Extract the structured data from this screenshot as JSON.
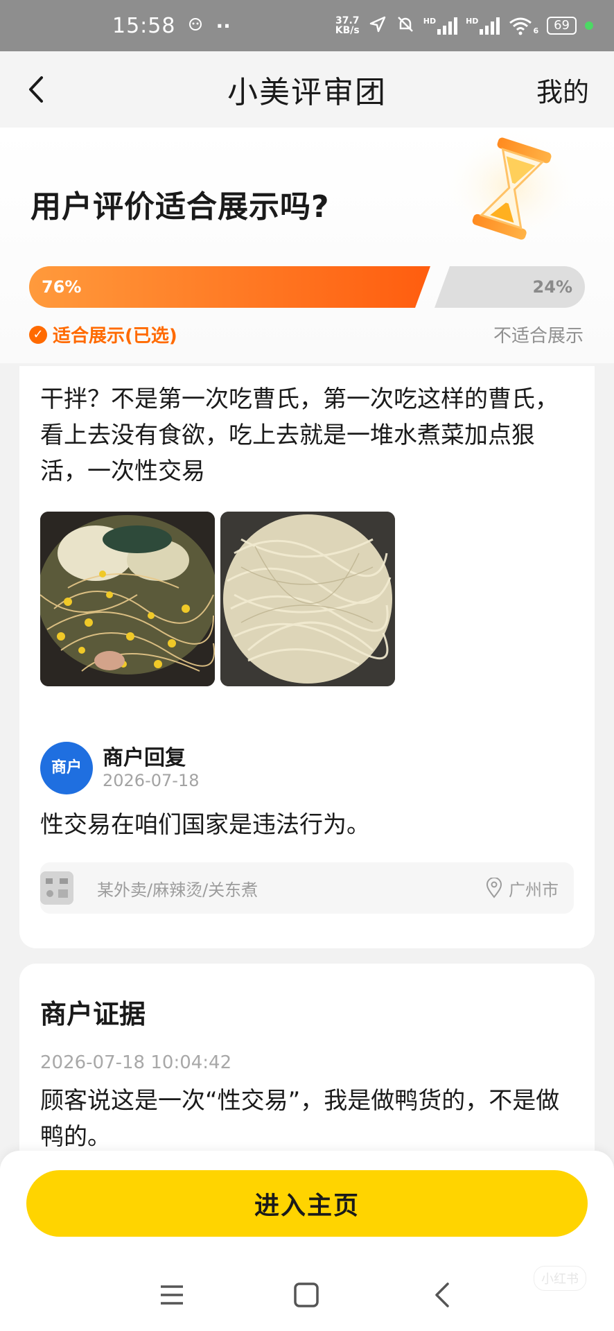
{
  "status_bar": {
    "time": "15:58",
    "net_speed_value": "37.7",
    "net_speed_unit": "KB/s",
    "hd1": "HD",
    "hd2": "HD",
    "wifi_label": "6",
    "battery": "69",
    "dots": "··"
  },
  "nav": {
    "title": "小美评审团",
    "right_label": "我的"
  },
  "poll": {
    "question": "用户评价适合展示吗?",
    "suitable_percent": 76,
    "suitable_label_pct": "76%",
    "unsuitable_label_pct": "24%",
    "suitable_label": "适合展示(已选)",
    "unsuitable_label": "不适合展示"
  },
  "review": {
    "text": "干拌？不是第一次吃曹氏，第一次吃这样的曹氏，看上去没有食欲，吃上去就是一堆水煮菜加点狠活，一次性交易",
    "photos": [
      "mixed-noodles-photo",
      "plain-noodles-photo"
    ]
  },
  "merchant_reply": {
    "avatar_text": "商户",
    "name": "商户回复",
    "date": "2026-07-18",
    "text": "性交易在咱们国家是违法行为。"
  },
  "shop": {
    "category": "某外卖/麻辣烫/关东煮",
    "location": "广州市"
  },
  "evidence": {
    "title": "商户证据",
    "time": "2026-07-18 10:04:42",
    "text": "顾客说这是一次“性交易”，我是做鸭货的，不是做鸭的。"
  },
  "actions": {
    "enter_home": "进入主页"
  },
  "watermark": "小红书",
  "colors": {
    "accent_orange": "#ff6a00",
    "cta_yellow": "#ffd400",
    "avatar_blue": "#1f6fe0"
  }
}
